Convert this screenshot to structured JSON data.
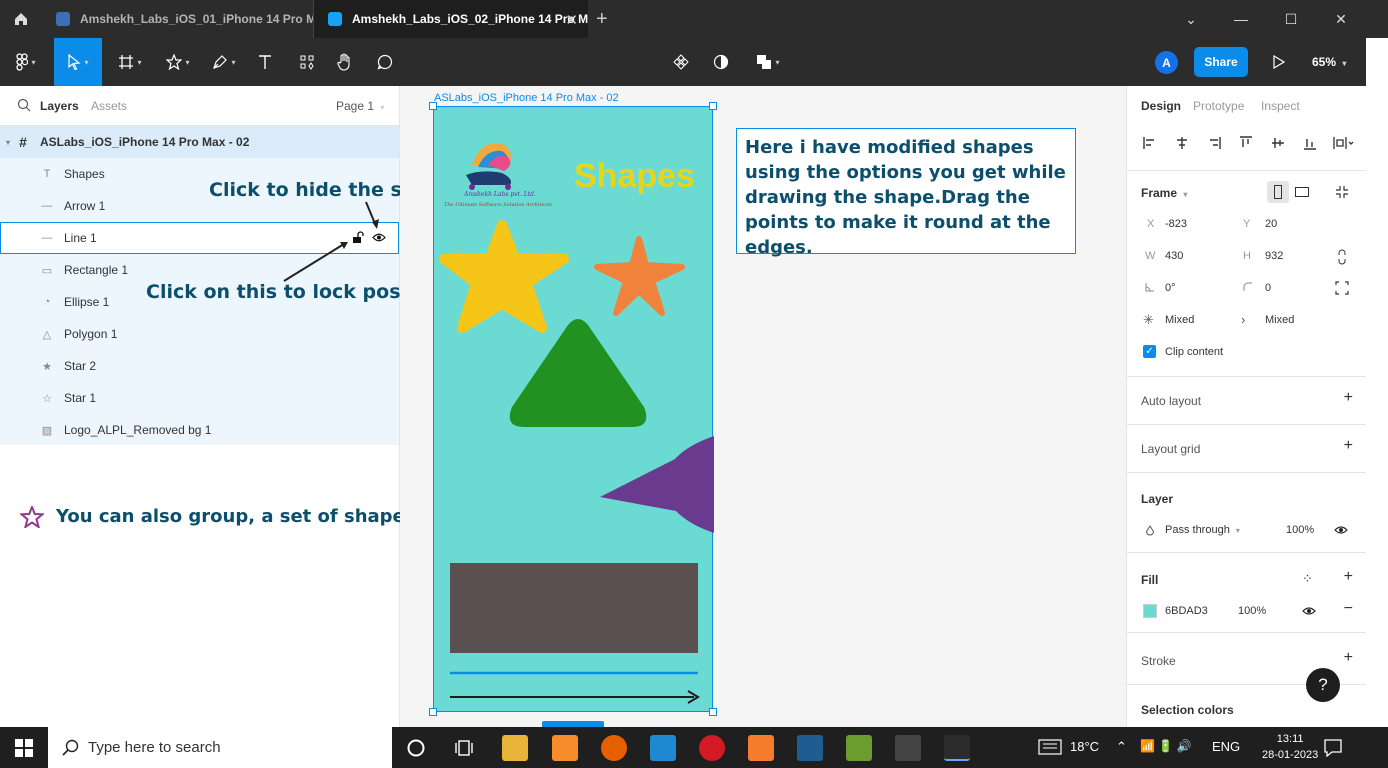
{
  "window": {
    "tabs": [
      {
        "label": "Amshekh_Labs_iOS_01_iPhone 14 Pro Ma"
      },
      {
        "label": "Amshekh_Labs_iOS_02_iPhone 14 Pro M"
      }
    ],
    "close_glyph": "✕"
  },
  "toolbar": {
    "avatar_initial": "A",
    "share_label": "Share",
    "zoom_label": "65%"
  },
  "left_panel": {
    "tabs": {
      "layers": "Layers",
      "assets": "Assets"
    },
    "page_label": "Page 1",
    "frame_name": "ASLabs_iOS_iPhone 14 Pro Max - 02",
    "layers": [
      {
        "name": "Shapes",
        "icon": "text-icon"
      },
      {
        "name": "Arrow 1",
        "icon": "line-icon"
      },
      {
        "name": "Line 1",
        "icon": "line-icon"
      },
      {
        "name": "Rectangle 1",
        "icon": "rectangle-icon"
      },
      {
        "name": "Ellipse 1",
        "icon": "ellipse-icon"
      },
      {
        "name": "Polygon 1",
        "icon": "polygon-icon"
      },
      {
        "name": "Star 2",
        "icon": "star-filled-icon"
      },
      {
        "name": "Star 1",
        "icon": "star-outline-icon"
      },
      {
        "name": "Logo_ALPL_Removed bg 1",
        "icon": "image-icon"
      }
    ],
    "annotations": {
      "hide": "Click to hide the shape",
      "lock": "Click on this to lock position",
      "group": "You can also group, a set of shapes."
    }
  },
  "canvas": {
    "frame_label": "ASLabs_iOS_iPhone 14 Pro Max - 02",
    "shapes_title": "Shapes",
    "logo_text": "Amshekh Labs pvt. Ltd.",
    "logo_tagline": "The Ultimate Software Solution Architects",
    "note": "Here i have modified shapes using the options you get while drawing the shape.Drag the points to make it round at the edges.",
    "colors": {
      "frame_fill": "#6BDAD3",
      "star": "#F5C518",
      "starfish": "#F0823C",
      "triangle": "#219221",
      "ellipse": "#6A3A8E",
      "rectangle": "#5A5050",
      "line": "#0C8CE9",
      "arrow": "#1E1E1E"
    }
  },
  "right_panel": {
    "tabs": {
      "design": "Design",
      "prototype": "Prototype",
      "inspect": "Inspect"
    },
    "frame_label": "Frame",
    "x_key": "X",
    "x": "-823",
    "y_key": "Y",
    "y": "20",
    "w_key": "W",
    "w": "430",
    "h_key": "H",
    "h": "932",
    "rotation": "0°",
    "radius": "0",
    "constraint_h": "Mixed",
    "constraint_v": "Mixed",
    "clip_content": "Clip content",
    "auto_layout": "Auto layout",
    "layout_grid": "Layout grid",
    "layer_title": "Layer",
    "blend_mode": "Pass through",
    "layer_opacity": "100%",
    "fill_title": "Fill",
    "fill_hex": "6BDAD3",
    "fill_opacity": "100%",
    "stroke_title": "Stroke",
    "selection_colors": "Selection colors",
    "help": "?"
  },
  "taskbar": {
    "search_placeholder": "Type here to search",
    "weather": "18°C",
    "language": "ENG",
    "time": "13:11",
    "date": "28-01-2023"
  }
}
